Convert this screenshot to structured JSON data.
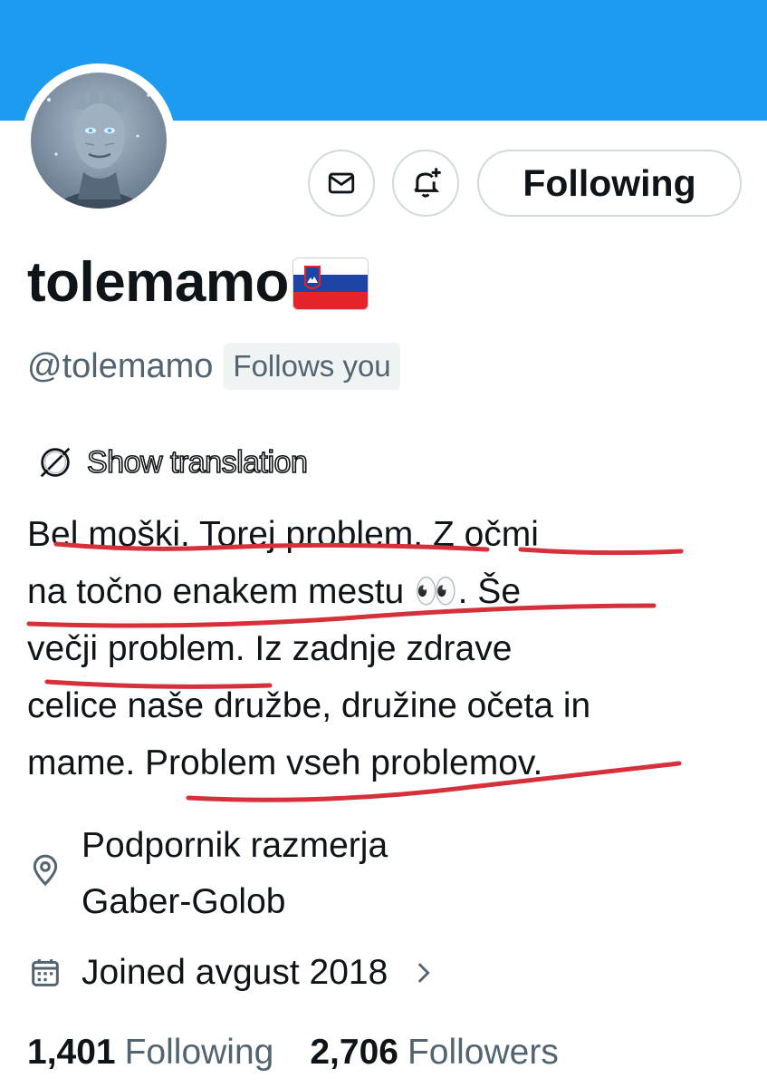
{
  "profile": {
    "display_name": "tolemamo",
    "flag_emoji": "🇸🇮",
    "handle": "@tolemamo",
    "follows_you_badge": "Follows you",
    "following_button": "Following",
    "show_translation": "Show translation",
    "bio_lines": [
      "Bel moški. Torej problem. Z očmi",
      "na točno enakem mestu 👀. Še",
      "večji problem. Iz zadnje zdrave",
      "celice naše družbe, družine očeta in",
      "mame. Problem vseh problemov."
    ],
    "location_lines": [
      "Podpornik razmerja",
      "Gaber-Golob"
    ],
    "joined": "Joined avgust 2018",
    "following_count": "1,401",
    "following_label": "Following",
    "followers_count": "2,706",
    "followers_label": "Followers"
  },
  "icons": {
    "message": "envelope-icon",
    "notify": "bell-plus-icon",
    "location": "map-pin-icon",
    "calendar": "calendar-icon",
    "chevron": "chevron-right-icon",
    "translate": "globe-translate-icon"
  },
  "colors": {
    "banner": "#1d9bf0",
    "primary_text": "#0f1419",
    "secondary_text": "#536471",
    "border": "#cfd9de",
    "annotation_underline": "#d6303a"
  }
}
